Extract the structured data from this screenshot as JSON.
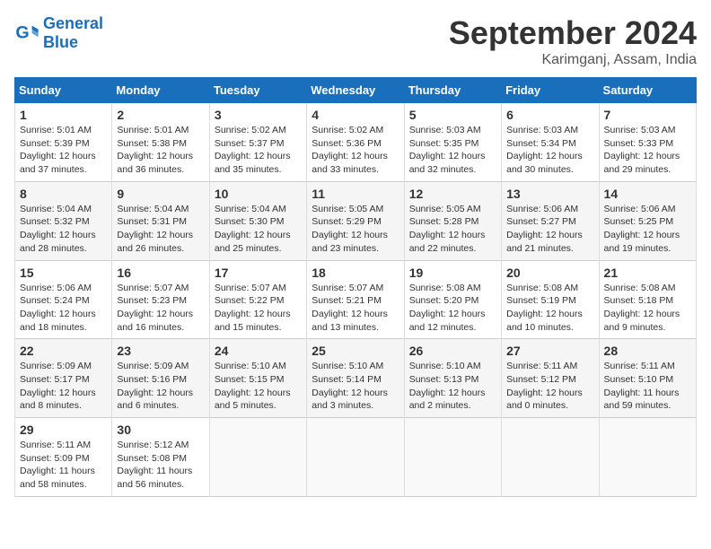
{
  "logo": {
    "line1": "General",
    "line2": "Blue"
  },
  "title": "September 2024",
  "location": "Karimganj, Assam, India",
  "headers": [
    "Sunday",
    "Monday",
    "Tuesday",
    "Wednesday",
    "Thursday",
    "Friday",
    "Saturday"
  ],
  "weeks": [
    [
      {
        "day": "1",
        "sunrise": "5:01 AM",
        "sunset": "5:39 PM",
        "daylight": "12 hours and 37 minutes."
      },
      {
        "day": "2",
        "sunrise": "5:01 AM",
        "sunset": "5:38 PM",
        "daylight": "12 hours and 36 minutes."
      },
      {
        "day": "3",
        "sunrise": "5:02 AM",
        "sunset": "5:37 PM",
        "daylight": "12 hours and 35 minutes."
      },
      {
        "day": "4",
        "sunrise": "5:02 AM",
        "sunset": "5:36 PM",
        "daylight": "12 hours and 33 minutes."
      },
      {
        "day": "5",
        "sunrise": "5:03 AM",
        "sunset": "5:35 PM",
        "daylight": "12 hours and 32 minutes."
      },
      {
        "day": "6",
        "sunrise": "5:03 AM",
        "sunset": "5:34 PM",
        "daylight": "12 hours and 30 minutes."
      },
      {
        "day": "7",
        "sunrise": "5:03 AM",
        "sunset": "5:33 PM",
        "daylight": "12 hours and 29 minutes."
      }
    ],
    [
      {
        "day": "8",
        "sunrise": "5:04 AM",
        "sunset": "5:32 PM",
        "daylight": "12 hours and 28 minutes."
      },
      {
        "day": "9",
        "sunrise": "5:04 AM",
        "sunset": "5:31 PM",
        "daylight": "12 hours and 26 minutes."
      },
      {
        "day": "10",
        "sunrise": "5:04 AM",
        "sunset": "5:30 PM",
        "daylight": "12 hours and 25 minutes."
      },
      {
        "day": "11",
        "sunrise": "5:05 AM",
        "sunset": "5:29 PM",
        "daylight": "12 hours and 23 minutes."
      },
      {
        "day": "12",
        "sunrise": "5:05 AM",
        "sunset": "5:28 PM",
        "daylight": "12 hours and 22 minutes."
      },
      {
        "day": "13",
        "sunrise": "5:06 AM",
        "sunset": "5:27 PM",
        "daylight": "12 hours and 21 minutes."
      },
      {
        "day": "14",
        "sunrise": "5:06 AM",
        "sunset": "5:25 PM",
        "daylight": "12 hours and 19 minutes."
      }
    ],
    [
      {
        "day": "15",
        "sunrise": "5:06 AM",
        "sunset": "5:24 PM",
        "daylight": "12 hours and 18 minutes."
      },
      {
        "day": "16",
        "sunrise": "5:07 AM",
        "sunset": "5:23 PM",
        "daylight": "12 hours and 16 minutes."
      },
      {
        "day": "17",
        "sunrise": "5:07 AM",
        "sunset": "5:22 PM",
        "daylight": "12 hours and 15 minutes."
      },
      {
        "day": "18",
        "sunrise": "5:07 AM",
        "sunset": "5:21 PM",
        "daylight": "12 hours and 13 minutes."
      },
      {
        "day": "19",
        "sunrise": "5:08 AM",
        "sunset": "5:20 PM",
        "daylight": "12 hours and 12 minutes."
      },
      {
        "day": "20",
        "sunrise": "5:08 AM",
        "sunset": "5:19 PM",
        "daylight": "12 hours and 10 minutes."
      },
      {
        "day": "21",
        "sunrise": "5:08 AM",
        "sunset": "5:18 PM",
        "daylight": "12 hours and 9 minutes."
      }
    ],
    [
      {
        "day": "22",
        "sunrise": "5:09 AM",
        "sunset": "5:17 PM",
        "daylight": "12 hours and 8 minutes."
      },
      {
        "day": "23",
        "sunrise": "5:09 AM",
        "sunset": "5:16 PM",
        "daylight": "12 hours and 6 minutes."
      },
      {
        "day": "24",
        "sunrise": "5:10 AM",
        "sunset": "5:15 PM",
        "daylight": "12 hours and 5 minutes."
      },
      {
        "day": "25",
        "sunrise": "5:10 AM",
        "sunset": "5:14 PM",
        "daylight": "12 hours and 3 minutes."
      },
      {
        "day": "26",
        "sunrise": "5:10 AM",
        "sunset": "5:13 PM",
        "daylight": "12 hours and 2 minutes."
      },
      {
        "day": "27",
        "sunrise": "5:11 AM",
        "sunset": "5:12 PM",
        "daylight": "12 hours and 0 minutes."
      },
      {
        "day": "28",
        "sunrise": "5:11 AM",
        "sunset": "5:10 PM",
        "daylight": "11 hours and 59 minutes."
      }
    ],
    [
      {
        "day": "29",
        "sunrise": "5:11 AM",
        "sunset": "5:09 PM",
        "daylight": "11 hours and 58 minutes."
      },
      {
        "day": "30",
        "sunrise": "5:12 AM",
        "sunset": "5:08 PM",
        "daylight": "11 hours and 56 minutes."
      },
      null,
      null,
      null,
      null,
      null
    ]
  ]
}
